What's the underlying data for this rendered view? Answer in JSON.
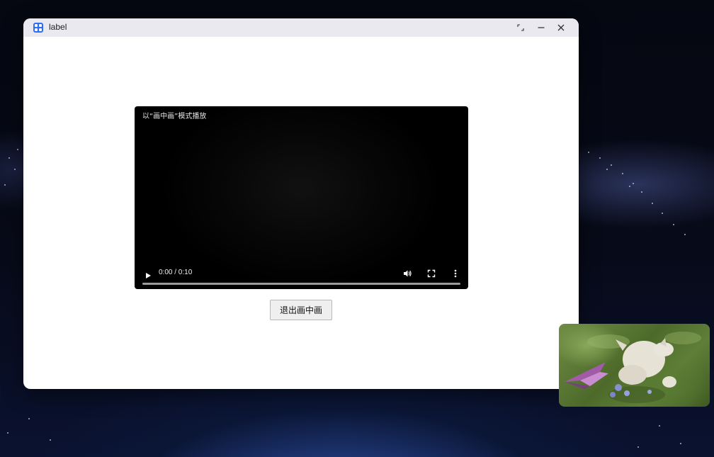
{
  "window": {
    "title": "label",
    "controls": {
      "restore_icon": "restore-icon",
      "minimize_icon": "minimize-icon",
      "close_icon": "close-icon"
    }
  },
  "video": {
    "caption": "以“画中画”模式播放",
    "time": "0:00 / 0:10",
    "progress": 0,
    "icons": [
      "play-icon",
      "volume-icon",
      "fullscreen-icon",
      "more-vertical-icon"
    ]
  },
  "buttons": {
    "exit_pip_label": "退出画中画"
  },
  "colors": {
    "accent": "#2f6df6",
    "titlebar": "#e9e9ef",
    "video_bg": "#000000"
  }
}
